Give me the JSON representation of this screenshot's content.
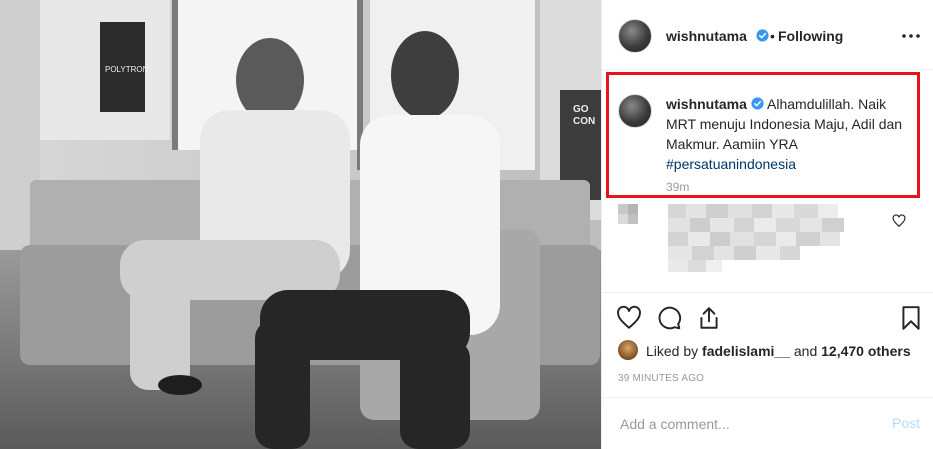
{
  "post": {
    "username": "wishnutama",
    "separator": "•",
    "follow_status": "Following",
    "more_icon": "more-horizontal-icon",
    "caption_username": "wishnutama",
    "caption_text": "Alhamdulillah. Naik MRT menuju Indonesia Maju, Adil dan Makmur. Aamiin YRA",
    "hashtag": "#persatuanindonesia",
    "caption_time": "39m",
    "likes_prefix": "Liked by",
    "liker": "fadelislami__",
    "likes_conj": "and",
    "likes_count": "12,470 others",
    "timestamp": "39 MINUTES AGO",
    "comment_placeholder": "Add a comment...",
    "post_label": "Post"
  },
  "photo": {
    "sign_text": "POLYTRON",
    "ad_text_1": "GO",
    "ad_text_2": "CON"
  },
  "icons": {
    "verified": "verified-badge-icon",
    "like": "heart-icon",
    "comment": "comment-icon",
    "share": "share-icon",
    "save": "bookmark-icon"
  },
  "colors": {
    "highlight_border": "#e8141c",
    "verified_blue": "#3897f0",
    "hashtag": "#003569",
    "post_button_disabled": "#b3dbff",
    "muted_text": "#999999"
  }
}
